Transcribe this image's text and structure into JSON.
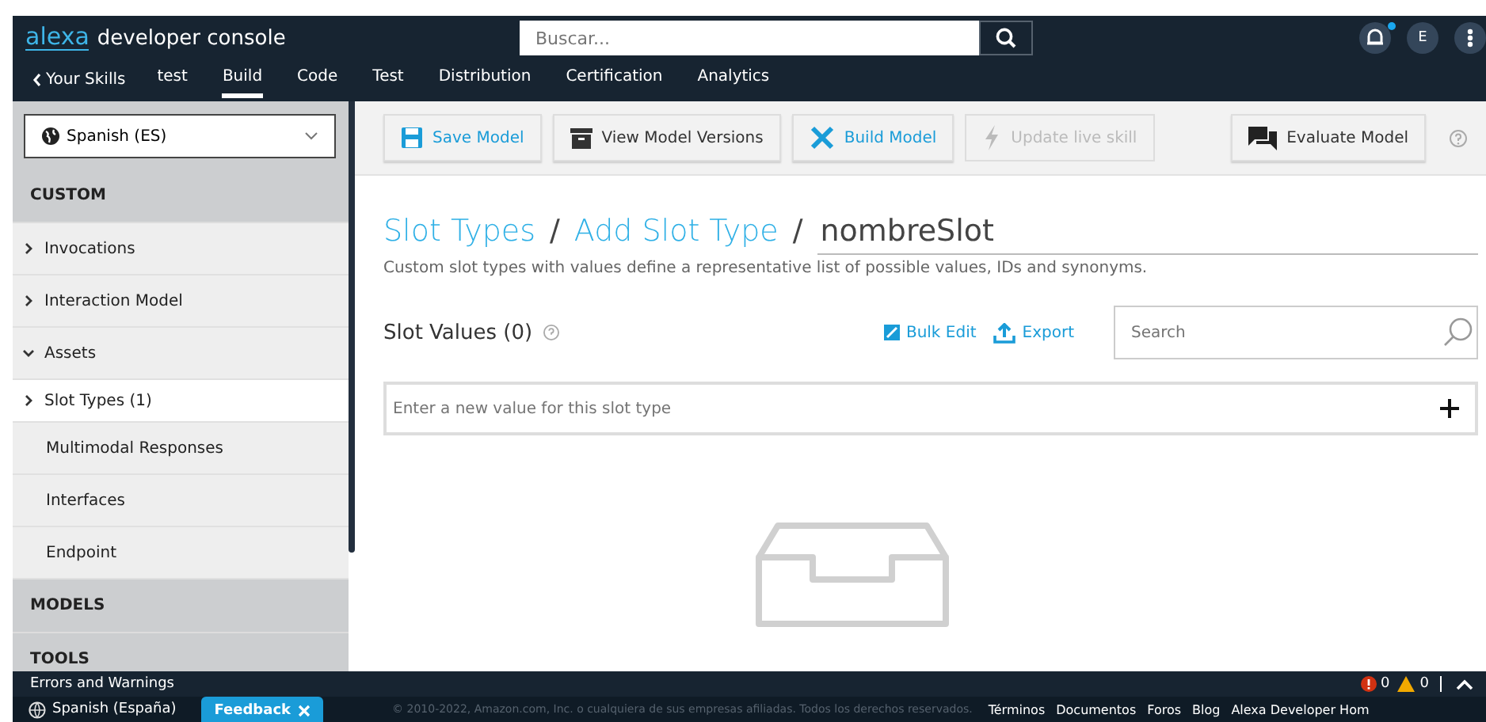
{
  "header": {
    "logo_word": "alexa",
    "logo_text": "developer console",
    "search": {
      "placeholder": "Buscar..."
    },
    "avatar": "E"
  },
  "nav": {
    "back": "Your Skills",
    "tabs": [
      {
        "label": "test",
        "selected": false
      },
      {
        "label": "Build",
        "selected": true
      },
      {
        "label": "Code",
        "selected": false
      },
      {
        "label": "Test",
        "selected": false
      },
      {
        "label": "Distribution",
        "selected": false
      },
      {
        "label": "Certification",
        "selected": false
      },
      {
        "label": "Analytics",
        "selected": false
      }
    ]
  },
  "sidebar": {
    "locale": "Spanish (ES)",
    "items": [
      {
        "kind": "header",
        "label": "CUSTOM",
        "selected": false
      },
      {
        "kind": "group",
        "label": "Invocations",
        "expanded": false,
        "selected": false
      },
      {
        "kind": "group",
        "label": "Interaction Model",
        "expanded": false,
        "selected": false
      },
      {
        "kind": "group",
        "label": "Assets",
        "expanded": true,
        "selected": false
      },
      {
        "kind": "group",
        "label": "Slot Types (1)",
        "expanded": false,
        "selected": true
      },
      {
        "kind": "leaf",
        "label": "Multimodal Responses",
        "selected": false
      },
      {
        "kind": "leaf",
        "label": "Interfaces",
        "selected": false
      },
      {
        "kind": "leaf",
        "label": "Endpoint",
        "selected": false
      },
      {
        "kind": "header",
        "label": "MODELS",
        "selected": false
      },
      {
        "kind": "header",
        "label": "TOOLS",
        "selected": false
      }
    ]
  },
  "toolbar": {
    "buttons": [
      {
        "kind": "save",
        "label": "Save Model",
        "highlighted": true,
        "disabled": false
      },
      {
        "kind": "versions",
        "label": "View Model Versions",
        "highlighted": false,
        "disabled": false
      },
      {
        "kind": "build",
        "label": "Build Model",
        "highlighted": true,
        "disabled": false
      },
      {
        "kind": "update",
        "label": "Update live skill",
        "highlighted": false,
        "disabled": true
      }
    ],
    "evaluate": "Evaluate Model"
  },
  "breadcrumb": {
    "links": [
      "Slot Types",
      "Add Slot Type"
    ],
    "separator": "/",
    "name_value": "nombreSlot"
  },
  "description": "Custom slot types with values define a representative list of possible values, IDs and synonyms.",
  "slot_values": {
    "title": "Slot Values (0)",
    "bulk_edit": "Bulk Edit",
    "export": "Export",
    "search": {
      "placeholder": "Search"
    },
    "new_value": {
      "placeholder": "Enter a new value for this slot type"
    }
  },
  "errors_bar": {
    "label": "Errors and Warnings",
    "errors": "0",
    "warnings": "0"
  },
  "footer": {
    "language": "Spanish (España)",
    "feedback": "Feedback",
    "copyright": "© 2010-2022, Amazon.com, Inc. o cualquiera de sus empresas afiliadas. Todos los derechos reservados.",
    "links": [
      "Términos",
      "Documentos",
      "Foros",
      "Blog",
      "Alexa Developer Hom"
    ]
  }
}
